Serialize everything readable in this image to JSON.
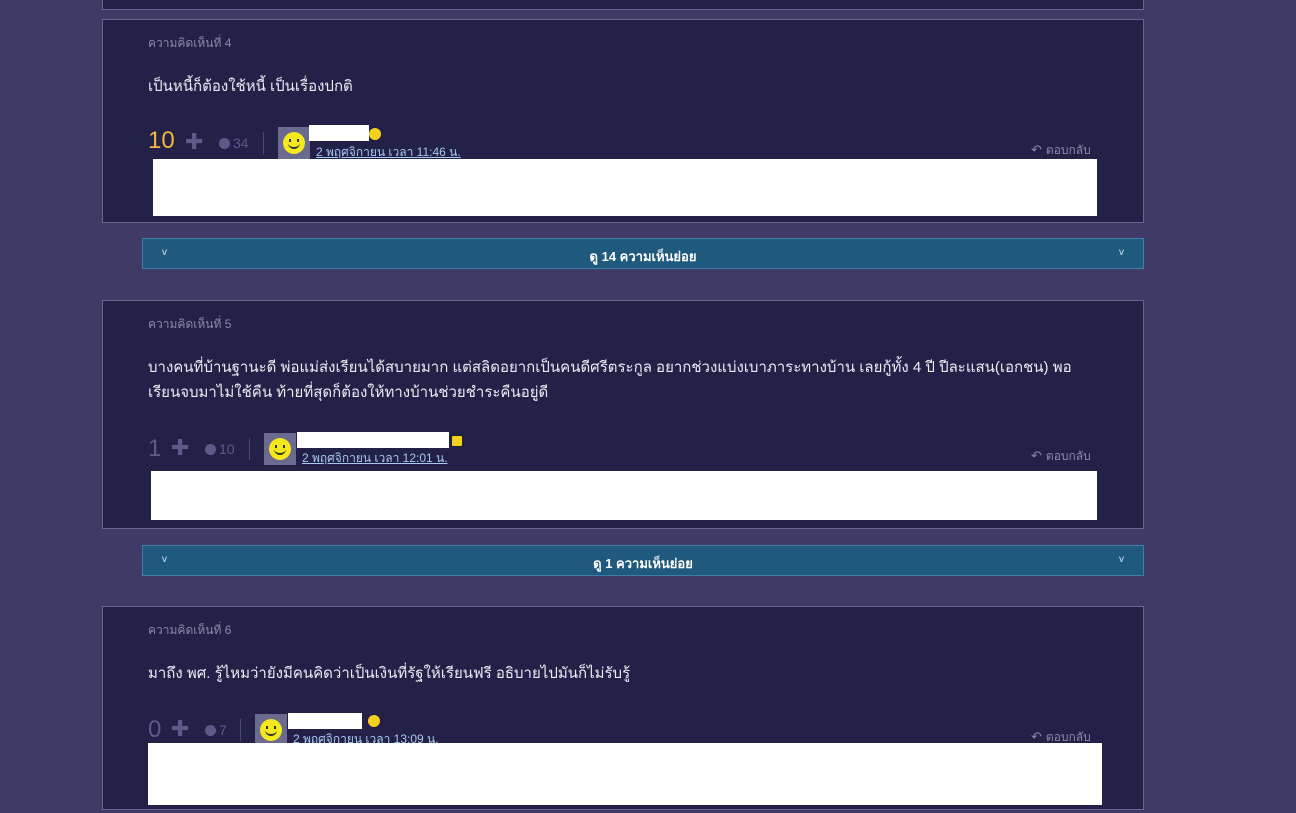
{
  "colors": {
    "page_bg": "#3f3b66",
    "card_bg": "#242149",
    "score_highlight": "#f2b93b",
    "score_muted": "#5d5a8a",
    "link": "#a6c8ee",
    "subcomment_bar": "#1f5a7e"
  },
  "icons": {
    "plus": "plus-icon",
    "emotion": "emotion-face-icon",
    "reply": "reply-arrow-icon",
    "chevron": "chevron-down-icon",
    "avatar": "smiley-avatar-icon"
  },
  "comments": [
    {
      "label": "ความคิดเห็นที่ 4",
      "text": "เป็นหนี้ก็ต้องใช้หนี้ เป็นเรื่องปกติ",
      "score": "10",
      "plus": "✚",
      "emotion_count": "34",
      "date": "2 พฤศจิกายน เวลา 11:46 น.",
      "reply": "ตอบกลับ",
      "reply_arrow": "↶"
    },
    {
      "label": "ความคิดเห็นที่ 5",
      "text": "บางคนที่บ้านฐานะดี พ่อแม่ส่งเรียนได้สบายมาก แต่สลิดอยากเป็นคนดีศรีตระกูล อยากช่วงแบ่งเบาภาระทางบ้าน เลยกู้ทั้ง 4 ปี ปีละแสน(เอกชน) พอเรียนจบมาไม่ใช้คืน ท้ายที่สุดก็ต้องให้ทางบ้านช่วยชำระคืนอยู่ดี",
      "score": "1",
      "plus": "✚",
      "emotion_count": "10",
      "date": "2 พฤศจิกายน เวลา 12:01 น.",
      "reply": "ตอบกลับ",
      "reply_arrow": "↶"
    },
    {
      "label": "ความคิดเห็นที่ 6",
      "text": "มาถึง พศ. รู้ไหมว่ายังมีคนคิดว่าเป็นเงินที่รัฐให้เรียนฟรี อธิบายไปมันก็ไม่รับรู้",
      "score": "0",
      "plus": "✚",
      "emotion_count": "7",
      "date": "2 พฤศจิกายน เวลา 13:09 น.",
      "reply": "ตอบกลับ",
      "reply_arrow": "↶"
    }
  ],
  "subcomment_bars": [
    {
      "label": "ดู 14 ความเห็นย่อย",
      "chevron": "v"
    },
    {
      "label": "ดู 1 ความเห็นย่อย",
      "chevron": "v"
    }
  ]
}
